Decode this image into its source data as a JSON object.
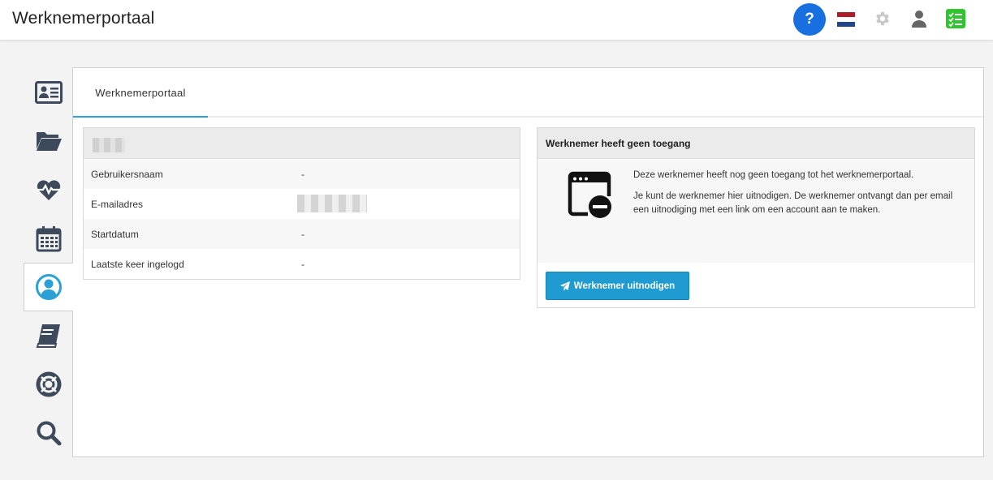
{
  "header": {
    "title": "Werknemerportaal",
    "help_label": "?",
    "icons": [
      "help-icon",
      "dutch-flag-icon",
      "gear-icon",
      "user-icon",
      "checklist-icon"
    ]
  },
  "sidebar": {
    "items": [
      {
        "name": "employee-card",
        "icon": "id-card-icon",
        "active": false
      },
      {
        "name": "documents",
        "icon": "folder-open-icon",
        "active": false
      },
      {
        "name": "health",
        "icon": "heartbeat-icon",
        "active": false
      },
      {
        "name": "calendar",
        "icon": "calendar-icon",
        "active": false
      },
      {
        "name": "employee-portal",
        "icon": "user-circle-icon",
        "active": true
      },
      {
        "name": "handbook",
        "icon": "book-icon",
        "active": false
      },
      {
        "name": "support",
        "icon": "life-ring-icon",
        "active": false
      },
      {
        "name": "search",
        "icon": "search-icon",
        "active": false
      }
    ]
  },
  "main": {
    "tab_label": "Werknemerportaal",
    "details": {
      "rows": [
        {
          "label": "Gebruikersnaam",
          "value": "-"
        },
        {
          "label": "E-mailadres",
          "value": ""
        },
        {
          "label": "Startdatum",
          "value": "-"
        },
        {
          "label": "Laatste keer ingelogd",
          "value": "-"
        }
      ]
    },
    "access": {
      "title": "Werknemer heeft geen toegang",
      "text1": "Deze werknemer heeft nog geen toegang tot het werknemerportaal.",
      "text2": "Je kunt de werknemer hier uitnodigen. De werknemer ontvangt dan per email een uitnodiging met een link om een account aan te maken.",
      "button_label": "Werknemer uitnodigen"
    }
  },
  "colors": {
    "accent": "#1f9bd1",
    "help": "#1a6fe0",
    "sidebar_icon": "#3d4a5c",
    "active_icon": "#2aa0d6",
    "check_green": "#2ec52e"
  }
}
